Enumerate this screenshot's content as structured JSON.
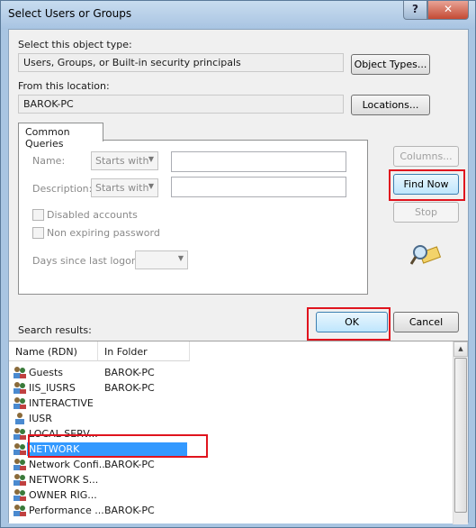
{
  "window": {
    "title": "Select Users or Groups",
    "help": "?",
    "close": "✕"
  },
  "object_type": {
    "label": "Select this object type:",
    "value": "Users, Groups, or Built-in security principals",
    "button": "Object Types..."
  },
  "location": {
    "label": "From this location:",
    "value": "BAROK-PC",
    "button": "Locations..."
  },
  "queries": {
    "tab": "Common Queries",
    "name_label": "Name:",
    "name_mode": "Starts with",
    "description_label": "Description:",
    "description_mode": "Starts with",
    "disabled_accounts": "Disabled accounts",
    "non_expiring_password": "Non expiring password",
    "days_label": "Days since last logon:"
  },
  "buttons": {
    "columns": "Columns...",
    "find_now": "Find Now",
    "stop": "Stop",
    "ok": "OK",
    "cancel": "Cancel"
  },
  "results": {
    "label": "Search results:",
    "columns": [
      "Name (RDN)",
      "In Folder"
    ],
    "rows": [
      {
        "name": "Guests",
        "folder": "BAROK-PC"
      },
      {
        "name": "IIS_IUSRS",
        "folder": "BAROK-PC"
      },
      {
        "name": "INTERACTIVE",
        "folder": ""
      },
      {
        "name": "IUSR",
        "folder": ""
      },
      {
        "name": "LOCAL SERV...",
        "folder": ""
      },
      {
        "name": "NETWORK",
        "folder": ""
      },
      {
        "name": "Network Confi...",
        "folder": "BAROK-PC"
      },
      {
        "name": "NETWORK S...",
        "folder": ""
      },
      {
        "name": "OWNER RIG...",
        "folder": ""
      },
      {
        "name": "Performance ...",
        "folder": "BAROK-PC"
      }
    ],
    "selected_row": "NETWORK"
  }
}
